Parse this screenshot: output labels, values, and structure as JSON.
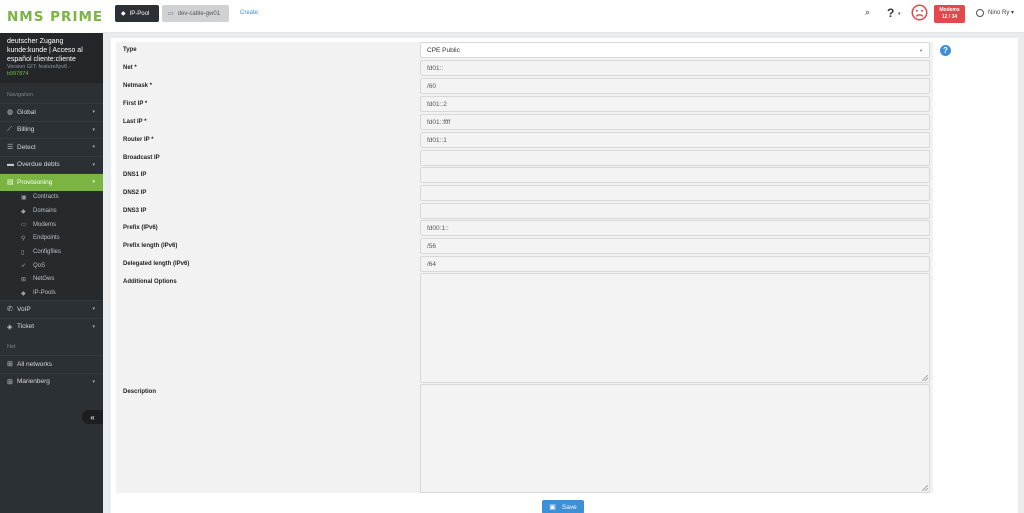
{
  "logo": {
    "text": "NMS PRIME"
  },
  "user_info": {
    "line1": "deutscher Zugang",
    "line2": "kunde:kunde | Acceso al",
    "line3": "español cliente:cliente",
    "version_label": "Version GIT: feature/ipv6 -",
    "version_hash": "b997874"
  },
  "sidebar": {
    "section_navigation": "Navigation",
    "items": [
      {
        "label": "Global",
        "icon": "globe-icon"
      },
      {
        "label": "Billing",
        "icon": "chart-icon"
      },
      {
        "label": "Detect",
        "icon": "sliders-icon"
      },
      {
        "label": "Overdue debts",
        "icon": "money-icon"
      },
      {
        "label": "Provisioning",
        "icon": "server-icon"
      }
    ],
    "subitems": [
      {
        "label": "Contracts",
        "icon": "address-book-icon"
      },
      {
        "label": "Domains",
        "icon": "tag-icon"
      },
      {
        "label": "Modems",
        "icon": "hdd-icon"
      },
      {
        "label": "Endpoints",
        "icon": "map-marker-icon"
      },
      {
        "label": "Configfiles",
        "icon": "file-code-icon"
      },
      {
        "label": "QoS",
        "icon": "rocket-icon"
      },
      {
        "label": "NetGws",
        "icon": "sitemap-icon"
      },
      {
        "label": "IP-Pools",
        "icon": "tags-icon"
      }
    ],
    "items_after": [
      {
        "label": "VoIP",
        "icon": "phone-icon"
      },
      {
        "label": "Ticket",
        "icon": "ticket-icon"
      }
    ],
    "section_net": "Net",
    "net_items": [
      {
        "label": "All networks",
        "icon": "sitemap-icon"
      },
      {
        "label": "Marienberg",
        "icon": "sitemap-icon"
      }
    ]
  },
  "topbar": {
    "crumbs": [
      "IP-Pool",
      "dev-cable-gw01"
    ],
    "create": "Create",
    "help": "?",
    "modems_badge_title": "Modems",
    "modems_badge_count": "12 / 34",
    "user": "Nino Ry"
  },
  "form": {
    "fields": [
      {
        "label": "Type",
        "value": "CPE Public"
      },
      {
        "label": "Net *",
        "value": "fd01::"
      },
      {
        "label": "Netmask *",
        "value": "/60"
      },
      {
        "label": "First IP *",
        "value": "fd01::2"
      },
      {
        "label": "Last IP *",
        "value": "fd01::ffff"
      },
      {
        "label": "Router IP *",
        "value": "fd01::1"
      },
      {
        "label": "Broadcast IP",
        "value": ""
      },
      {
        "label": "DNS1 IP",
        "value": ""
      },
      {
        "label": "DNS2 IP",
        "value": ""
      },
      {
        "label": "DNS3 IP",
        "value": ""
      },
      {
        "label": "Prefix (IPv6)",
        "value": "fd00:1::"
      },
      {
        "label": "Prefix length (IPv6)",
        "value": "/56"
      },
      {
        "label": "Delegated length (IPv6)",
        "value": "/64"
      }
    ],
    "additional_options_label": "Additional Options",
    "description_label": "Description",
    "save": "Save"
  },
  "colors": {
    "accent_green": "#7ab541",
    "sidebar_bg": "#2b3034",
    "primary_blue": "#3d8fd6",
    "danger_red": "#e2494c"
  }
}
